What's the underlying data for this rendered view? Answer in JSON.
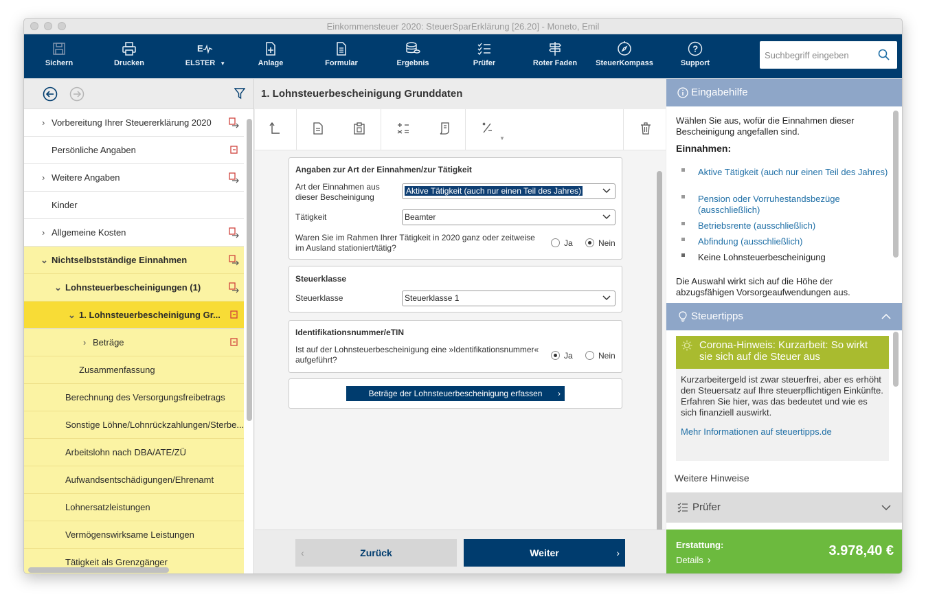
{
  "window": {
    "title": "Einkommensteuer 2020: SteuerSparErklärung [26.20] - Moneto, Emil"
  },
  "toolbar": {
    "buttons": [
      {
        "label": "Sichern",
        "icon": "save-icon"
      },
      {
        "label": "Drucken",
        "icon": "printer-icon"
      },
      {
        "label": "ELSTER",
        "icon": "elster-icon"
      },
      {
        "label": "Anlage",
        "icon": "add-document-icon"
      },
      {
        "label": "Formular",
        "icon": "form-icon"
      },
      {
        "label": "Ergebnis",
        "icon": "coins-icon"
      },
      {
        "label": "Prüfer",
        "icon": "checklist-icon"
      },
      {
        "label": "Roter Faden",
        "icon": "signpost-icon"
      },
      {
        "label": "SteuerKompass",
        "icon": "compass-icon"
      },
      {
        "label": "Support",
        "icon": "help-icon"
      }
    ],
    "search_placeholder": "Suchbegriff eingeben"
  },
  "sidebar": {
    "items": [
      {
        "label": "Vorbereitung Ihrer Steuererklärung 2020"
      },
      {
        "label": "Persönliche Angaben"
      },
      {
        "label": "Weitere Angaben"
      },
      {
        "label": "Kinder"
      },
      {
        "label": "Allgemeine Kosten"
      },
      {
        "label": "Nichtselbstständige Einnahmen"
      },
      {
        "label": "Lohnsteuerbescheinigungen (1)"
      },
      {
        "label": "1. Lohnsteuerbescheinigung Gr..."
      },
      {
        "label": "Beträge"
      },
      {
        "label": "Zusammenfassung"
      },
      {
        "label": "Berechnung des Versorgungsfreibetrags"
      },
      {
        "label": "Sonstige Löhne/Lohnrückzahlungen/Sterbe..."
      },
      {
        "label": "Arbeitslohn nach DBA/ATE/ZÜ"
      },
      {
        "label": "Aufwandsentschädigungen/Ehrenamt"
      },
      {
        "label": "Lohnersatzleistungen"
      },
      {
        "label": "Vermögenswirksame Leistungen"
      },
      {
        "label": "Tätigkeit als Grenzgänger"
      }
    ]
  },
  "main": {
    "title": "1. Lohnsteuerbescheinigung Grunddaten",
    "section1": {
      "heading": "Angaben zur Art der Einnahmen/zur Tätigkeit",
      "art_label": "Art der Einnahmen aus dieser Bescheinigung",
      "art_value": "Aktive Tätigkeit (auch nur einen Teil des Jahres)",
      "taetigkeit_label": "Tätigkeit",
      "taetigkeit_value": "Beamter",
      "ausland_question": "Waren Sie im Rahmen Ihrer Tätigkeit in 2020 ganz oder zeitweise im Ausland stationiert/tätig?",
      "ja": "Ja",
      "nein": "Nein"
    },
    "section2": {
      "heading": "Steuerklasse",
      "label": "Steuerklasse",
      "value": "Steuerklasse 1"
    },
    "section3": {
      "heading": "Identifikationsnummer/eTIN",
      "question": "Ist auf der Lohnsteuerbescheinigung eine »Identifikationsnummer« aufgeführt?",
      "ja": "Ja",
      "nein": "Nein"
    },
    "cta_label": "Beträge der Lohnsteuerbescheinigung erfassen",
    "back_label": "Zurück",
    "next_label": "Weiter"
  },
  "help": {
    "title": "Eingabehilfe",
    "intro": "Wählen Sie aus, wofür die Einnahmen dieser Bescheinigung angefallen sind.",
    "einnahmen_heading": "Einnahmen:",
    "list": [
      "Aktive Tätigkeit (auch nur einen Teil des Jahres)",
      "Pension oder Vorruhestandsbezüge (ausschließlich)",
      "Betriebsrente (ausschließlich)",
      "Abfindung (ausschließlich)",
      "Keine Lohnsteuerbescheinigung"
    ],
    "outro": "Die Auswahl wirkt sich auf die Höhe der abzugsfähigen Vorsorgeaufwendungen aus."
  },
  "tipps": {
    "title": "Steuertipps",
    "card_title": "Corona-Hinweis: Kurzarbeit: So wirkt sie sich auf die Steuer aus",
    "card_text": "Kurzarbeitergeld ist zwar steuerfrei, aber es erhöht den Steuersatz auf Ihre steuerpflichtigen Einkünfte. Erfahren Sie hier, was das bedeutet und wie es sich finanziell auswirkt.",
    "card_link": "Mehr Informationen auf steuertipps.de",
    "weitere": "Weitere Hinweise"
  },
  "pruefer": {
    "title": "Prüfer"
  },
  "erstattung": {
    "label": "Erstattung:",
    "details": "Details",
    "amount": "3.978,40 €"
  },
  "colors": {
    "toolbar": "#003c6e",
    "accent_yellow": "#f8dc36",
    "sidebar_yellow": "#fbf3a3",
    "refund_green": "#6cba3e",
    "tip_green": "#a9bb2f",
    "panel_blue": "#8ea6c8"
  }
}
